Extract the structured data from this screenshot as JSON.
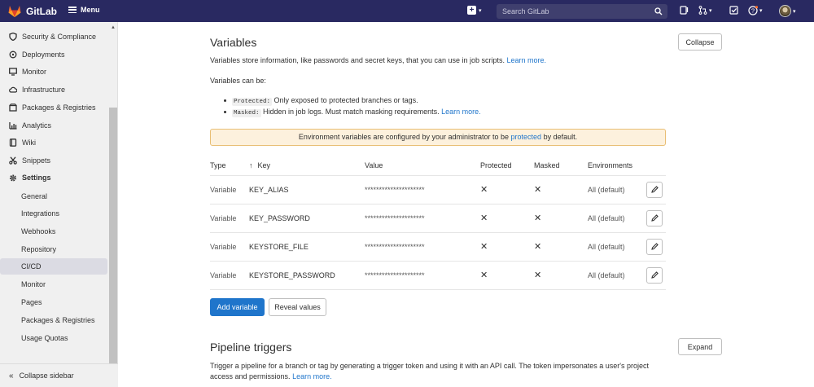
{
  "topbar": {
    "brand": "GitLab",
    "menu_label": "Menu",
    "search_placeholder": "Search GitLab"
  },
  "sidebar": {
    "items": [
      {
        "label": "Security & Compliance",
        "icon": "shield-icon"
      },
      {
        "label": "Deployments",
        "icon": "rocket-icon"
      },
      {
        "label": "Monitor",
        "icon": "monitor-icon"
      },
      {
        "label": "Infrastructure",
        "icon": "cloud-icon"
      },
      {
        "label": "Packages & Registries",
        "icon": "package-icon"
      },
      {
        "label": "Analytics",
        "icon": "chart-icon"
      },
      {
        "label": "Wiki",
        "icon": "book-icon"
      },
      {
        "label": "Snippets",
        "icon": "scissors-icon"
      },
      {
        "label": "Settings",
        "icon": "gear-icon"
      }
    ],
    "subitems": [
      "General",
      "Integrations",
      "Webhooks",
      "Repository",
      "CI/CD",
      "Monitor",
      "Pages",
      "Packages & Registries",
      "Usage Quotas"
    ],
    "active_subitem": "CI/CD",
    "collapse_label": "Collapse sidebar"
  },
  "variables": {
    "title": "Variables",
    "collapse_label": "Collapse",
    "description": "Variables store information, like passwords and secret keys, that you can use in job scripts.",
    "learn_more": "Learn more.",
    "can_be": "Variables can be:",
    "protected_code": "Protected:",
    "protected_text": "Only exposed to protected branches or tags.",
    "masked_code": "Masked:",
    "masked_text": "Hidden in job logs. Must match masking requirements.",
    "masked_learn_more": "Learn more.",
    "alert_prefix": "Environment variables are configured by your administrator to be",
    "alert_link": "protected",
    "alert_suffix": "by default.",
    "columns": {
      "type": "Type",
      "key": "Key",
      "value": "Value",
      "protected": "Protected",
      "masked": "Masked",
      "environments": "Environments"
    },
    "rows": [
      {
        "type": "Variable",
        "key": "KEY_ALIAS",
        "value": "*********************",
        "environments": "All (default)"
      },
      {
        "type": "Variable",
        "key": "KEY_PASSWORD",
        "value": "*********************",
        "environments": "All (default)"
      },
      {
        "type": "Variable",
        "key": "KEYSTORE_FILE",
        "value": "*********************",
        "environments": "All (default)"
      },
      {
        "type": "Variable",
        "key": "KEYSTORE_PASSWORD",
        "value": "*********************",
        "environments": "All (default)"
      }
    ],
    "add_label": "Add variable",
    "reveal_label": "Reveal values"
  },
  "triggers": {
    "title": "Pipeline triggers",
    "expand_label": "Expand",
    "description_line1": "Trigger a pipeline for a branch or tag by generating a trigger token and using it with an API call. The token impersonates a user's project",
    "description_line2": "access and permissions.",
    "learn_more": "Learn more."
  },
  "colors": {
    "topbar": "#292961",
    "primary": "#1f75cb",
    "alert_bg": "#fdf1dd"
  }
}
